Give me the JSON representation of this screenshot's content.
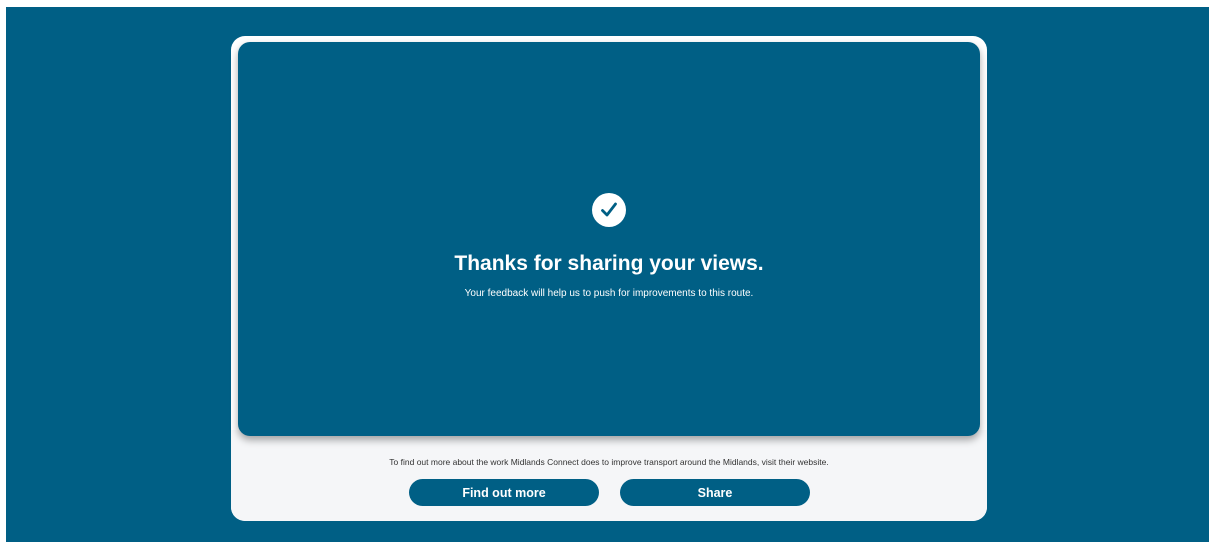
{
  "confirmation": {
    "icon": "checkmark-icon",
    "title": "Thanks for sharing your views.",
    "message": "Your feedback will help us to push for improvements to this route."
  },
  "footer": {
    "info_text": "To find out more about the work Midlands Connect does to improve transport around the Midlands, visit their website.",
    "find_out_more_label": "Find out more",
    "share_label": "Share"
  },
  "colors": {
    "background": "#005f85",
    "card": "#f5f6f8",
    "button": "#005f85"
  }
}
